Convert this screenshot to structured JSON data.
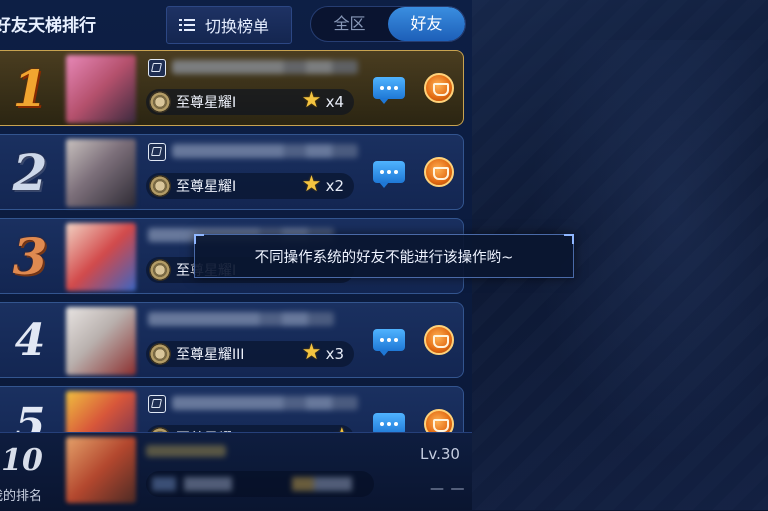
{
  "header": {
    "title": "好友天梯排行",
    "switch_label": "切换榜单",
    "tabs": [
      {
        "label": "全区",
        "active": false
      },
      {
        "label": "好友",
        "active": true
      }
    ]
  },
  "ranking": [
    {
      "rank": "1",
      "tier": "至尊星耀I",
      "stars": "x4",
      "style": "gold"
    },
    {
      "rank": "2",
      "tier": "至尊星耀I",
      "stars": "x2",
      "style": "silver"
    },
    {
      "rank": "3",
      "tier": "至尊星耀I",
      "stars": "",
      "style": "bronze"
    },
    {
      "rank": "4",
      "tier": "至尊星耀III",
      "stars": "x3",
      "style": "plain"
    },
    {
      "rank": "5",
      "tier": "至尊星耀V",
      "stars": "",
      "style": "plain"
    }
  ],
  "my_rank": {
    "rank": "10",
    "label": "我的排名",
    "level": "Lv.30",
    "dash": "— —"
  },
  "toast": {
    "message": "不同操作系统的好友不能进行该操作哟~"
  },
  "colors": {
    "accent": "#2f86e0",
    "gold": "#f2a530",
    "panel": "#0d1f45"
  }
}
